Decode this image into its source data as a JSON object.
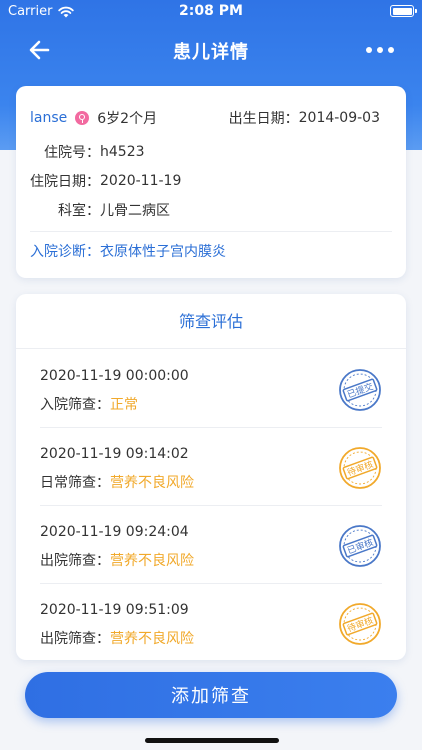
{
  "status": {
    "carrier": "Carrier",
    "time": "2:08 PM"
  },
  "nav": {
    "title": "患儿详情"
  },
  "patient": {
    "name": "lanse",
    "age": "6岁2个月",
    "birth_label": "出生日期：",
    "birth_value": "2014-09-03",
    "admission_no_label": "住院号：",
    "admission_no_value": "h4523",
    "admission_date_label": "住院日期：",
    "admission_date_value": "2020-11-19",
    "dept_label": "科室：",
    "dept_value": "儿骨二病区",
    "diagnosis_label": "入院诊断：",
    "diagnosis_value": "衣原体性子宫内膜炎"
  },
  "screening": {
    "title": "筛查评估",
    "items": [
      {
        "time": "2020-11-19 00:00:00",
        "type": "入院筛查：",
        "result": "正常",
        "stamp": "已提交",
        "stamp_color": "#4a78c8"
      },
      {
        "time": "2020-11-19 09:14:02",
        "type": "日常筛查：",
        "result": "营养不良风险",
        "stamp": "待审核",
        "stamp_color": "#f1a92b"
      },
      {
        "time": "2020-11-19 09:24:04",
        "type": "出院筛查：",
        "result": "营养不良风险",
        "stamp": "已审核",
        "stamp_color": "#4a78c8"
      },
      {
        "time": "2020-11-19 09:51:09",
        "type": "出院筛查：",
        "result": "营养不良风险",
        "stamp": "待审核",
        "stamp_color": "#f1a92b"
      }
    ]
  },
  "actions": {
    "add_label": "添加筛查"
  },
  "colors": {
    "primary": "#2f74e6",
    "warning": "#f1a92b",
    "link": "#2b6fd6"
  }
}
